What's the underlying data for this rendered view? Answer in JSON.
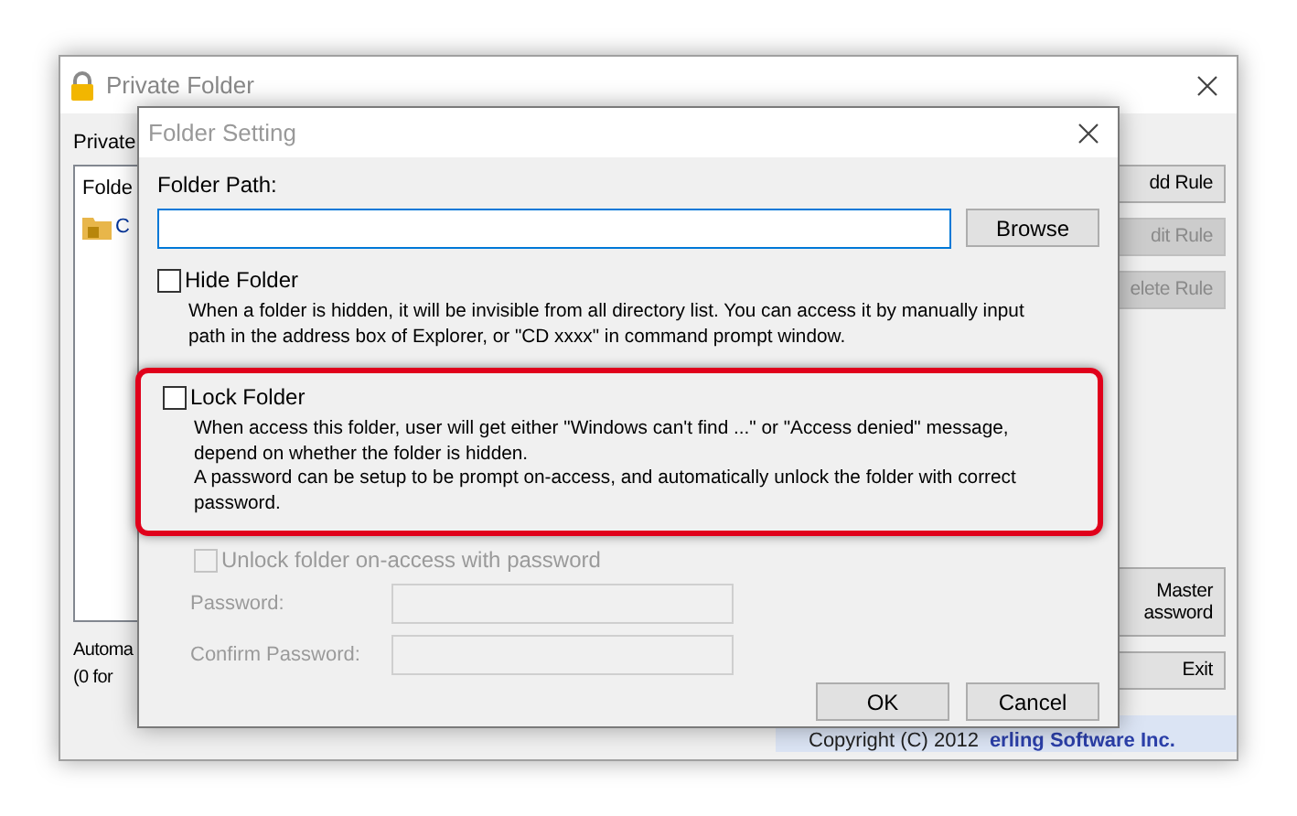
{
  "background_window": {
    "title": "Private Folder",
    "label": "Private",
    "list_header": "Folde",
    "list_items": [
      {
        "text": "C"
      }
    ],
    "buttons": [
      {
        "lines": [
          "dd Rule"
        ],
        "disabled": false
      },
      {
        "lines": [
          "dit Rule"
        ],
        "disabled": true
      },
      {
        "lines": [
          "elete Rule"
        ],
        "disabled": true
      },
      {
        "lines": [
          "Master",
          "assword"
        ],
        "disabled": false
      },
      {
        "lines": [
          "Exit"
        ],
        "disabled": false
      }
    ],
    "note_lines": [
      "Automa",
      "(0 for"
    ],
    "copyright": "Copyright (C) 2012",
    "company": "erling Software Inc."
  },
  "dialog": {
    "title": "Folder Setting",
    "path_label": "Folder Path:",
    "browse": "Browse",
    "options": [
      {
        "label": "Hide Folder",
        "checked": false,
        "highlighted": false,
        "description": [
          "When a folder is hidden, it will be invisible from all directory list. You can access it by manually input",
          "path in the address box of Explorer, or \"CD xxxx\" in command prompt window."
        ]
      },
      {
        "label": "Lock Folder",
        "checked": false,
        "highlighted": true,
        "description": [
          "When access this folder, user will get either \"Windows can't find ...\" or \"Access denied\" message,",
          "depend on whether the folder is hidden.",
          "A password can be setup to be prompt on-access, and automatically unlock the folder with correct",
          "password."
        ]
      }
    ],
    "unlock": {
      "label": "Unlock folder on-access with password",
      "checked": false,
      "disabled": true
    },
    "fields": [
      {
        "label": "Password:",
        "disabled": true
      },
      {
        "label": "Confirm Password:",
        "disabled": true
      }
    ],
    "buttons": [
      "OK",
      "Cancel"
    ]
  }
}
